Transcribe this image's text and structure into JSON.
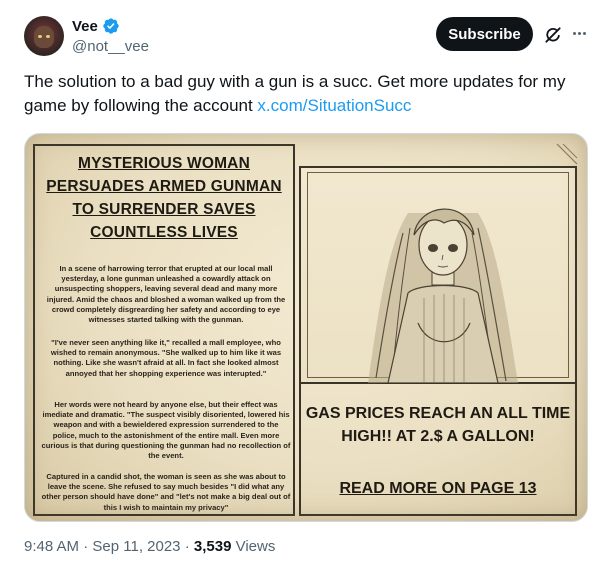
{
  "author": {
    "display_name": "Vee",
    "handle": "@not__vee",
    "verified": true
  },
  "actions": {
    "subscribe_label": "Subscribe",
    "grok_icon": "grok-icon",
    "more_icon": "more-options-icon"
  },
  "tweet": {
    "text": "The solution to a bad guy with a gun is a succ.  Get more updates for my game by following the account ",
    "link": "x.com/SituationSucc"
  },
  "newspaper": {
    "headline": "MYSTERIOUS WOMAN PERSUADES ARMED GUNMAN TO SURRENDER SAVES COUNTLESS LIVES",
    "paragraph_1": "In a scene of harrowing terror that erupted at our local mall yesterday, a lone gunman unleashed a cowardly attack on unsuspecting shoppers, leaving several dead and many more injured. Amid the chaos and bloshed a woman walked up from the crowd completely disgrearding her safety and according to eye witnesses started talking with the gunman.",
    "paragraph_2": "\"I've never seen anything like it,\" recalled a mall employee, who wished to remain anonymous. \"She walked up to him like it was nothing. Like she wasn't afraid at all. In fact she looked almost annoyed that her shopping experience was interupted.\"",
    "paragraph_3": "Her words were not heard by anyone else, but their effect was imediate and dramatic. \"The suspect visibly disoriented, lowered his weapon and with a bewieldered expression surrendered to the police, much to the astonishment of the entire mall. Even more curious is that during questioning the gunman had no recollection of the event.",
    "paragraph_4": "Captured in a candid shot, the woman is seen as she was about to leave the scene. She refused to say much besides \"I did what any other person should have done\" and \"let's not make a big deal out of this I wish to maintain my privacy\"",
    "side_headline": "GAS PRICES REACH AN ALL TIME HIGH!! AT 2.$ A GALLON!",
    "read_more": "READ MORE ON PAGE 13"
  },
  "footer": {
    "time": "9:48 AM",
    "separator": "·",
    "date": "Sep 11, 2023",
    "views_count": "3,539",
    "views_label": "Views"
  },
  "colors": {
    "accent_blue": "#1d9bf0",
    "text_primary": "#0f1419",
    "text_secondary": "#536471",
    "paper": "#eadfc2"
  }
}
